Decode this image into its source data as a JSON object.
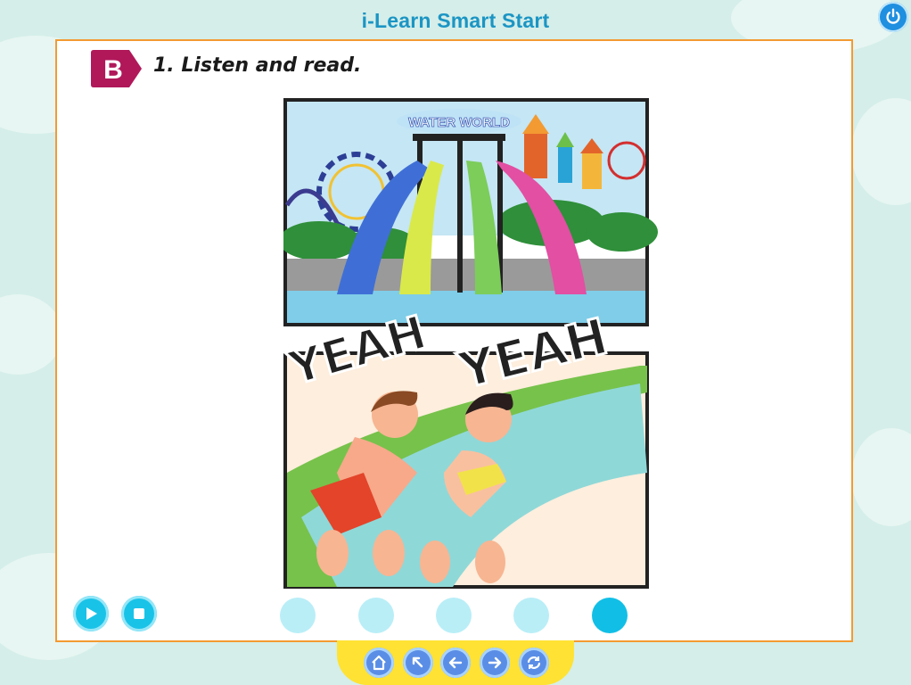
{
  "app": {
    "title": "i-Learn Smart Start"
  },
  "lesson": {
    "section": "B",
    "instruction": "1. Listen and read."
  },
  "illustration": {
    "sign_text": "WATER WORLD",
    "shout_1": "YEAH",
    "shout_2": "YEAH"
  },
  "controls": {
    "play": "play-icon",
    "stop": "stop-icon",
    "page_dots": 5,
    "active_dot": 5
  },
  "nav": [
    "home-icon",
    "back-arrow-icon",
    "previous-icon",
    "next-icon",
    "refresh-icon"
  ],
  "colors": {
    "frame_border": "#f39a32",
    "title": "#1b95c4",
    "cyan": "#19c3e8",
    "nav_bar": "#ffe233",
    "badge": "#b0185a"
  }
}
